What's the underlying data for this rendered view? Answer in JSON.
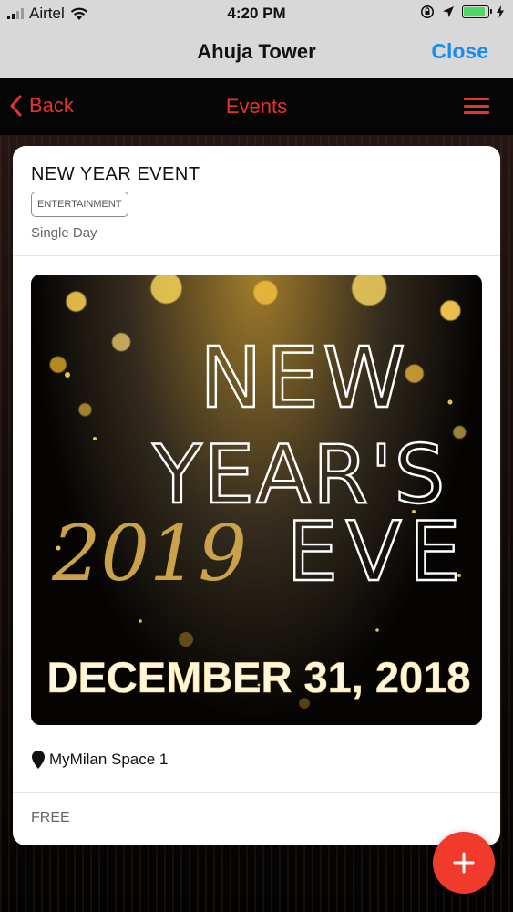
{
  "status_bar": {
    "carrier": "Airtel",
    "time": "4:20 PM",
    "battery_percent": 90
  },
  "title_bar": {
    "title": "Ahuja Tower",
    "close_label": "Close"
  },
  "nav": {
    "back_label": "Back",
    "title": "Events"
  },
  "event": {
    "title": "NEW YEAR EVENT",
    "category": "ENTERTAINMENT",
    "duration": "Single Day",
    "poster": {
      "line1": "NEW",
      "line2": "YEAR'S",
      "year": "2019",
      "line3": "EVE",
      "date": "DECEMBER 31, 2018"
    },
    "location": "MyMilan Space 1",
    "price": "FREE"
  },
  "colors": {
    "accent": "#e5342b",
    "link": "#1a8cf0",
    "fab": "#f03a2c",
    "gold": "#c9a24a"
  },
  "icons": [
    "wifi-icon",
    "signal-icon",
    "orientation-lock-icon",
    "location-arrow-icon",
    "battery-icon",
    "charging-icon",
    "chevron-left-icon",
    "hamburger-menu-icon",
    "map-pin-icon",
    "plus-icon"
  ]
}
